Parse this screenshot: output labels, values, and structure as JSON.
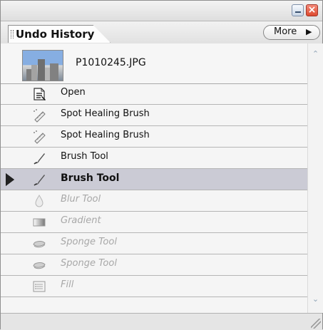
{
  "panel": {
    "tab": {
      "label": "Undo History"
    },
    "more_button": {
      "label": "More",
      "arrow": "▶"
    },
    "snapshot": {
      "label": "P1010245.JPG"
    },
    "history_items": [
      {
        "label": "Open",
        "icon": "document-open-icon",
        "state": "normal"
      },
      {
        "label": "Spot Healing Brush",
        "icon": "spot-healing-brush-icon",
        "state": "normal"
      },
      {
        "label": "Spot Healing Brush",
        "icon": "spot-healing-brush-icon",
        "state": "normal"
      },
      {
        "label": "Brush Tool",
        "icon": "brush-icon",
        "state": "normal"
      },
      {
        "label": "Brush Tool",
        "icon": "brush-icon",
        "state": "selected"
      },
      {
        "label": "Blur Tool",
        "icon": "blur-drop-icon",
        "state": "future"
      },
      {
        "label": "Gradient",
        "icon": "gradient-icon",
        "state": "future"
      },
      {
        "label": "Sponge Tool",
        "icon": "sponge-icon",
        "state": "future"
      },
      {
        "label": "Sponge Tool",
        "icon": "sponge-icon",
        "state": "future"
      },
      {
        "label": "Fill",
        "icon": "fill-icon",
        "state": "future"
      }
    ]
  },
  "window_controls": {
    "minimize_icon": "minimize-icon",
    "close_icon": "close-icon"
  },
  "colors": {
    "selected_row": "#cbcbd5",
    "future_text": "#a8a8a8",
    "close_button": "#dd4a2f"
  }
}
